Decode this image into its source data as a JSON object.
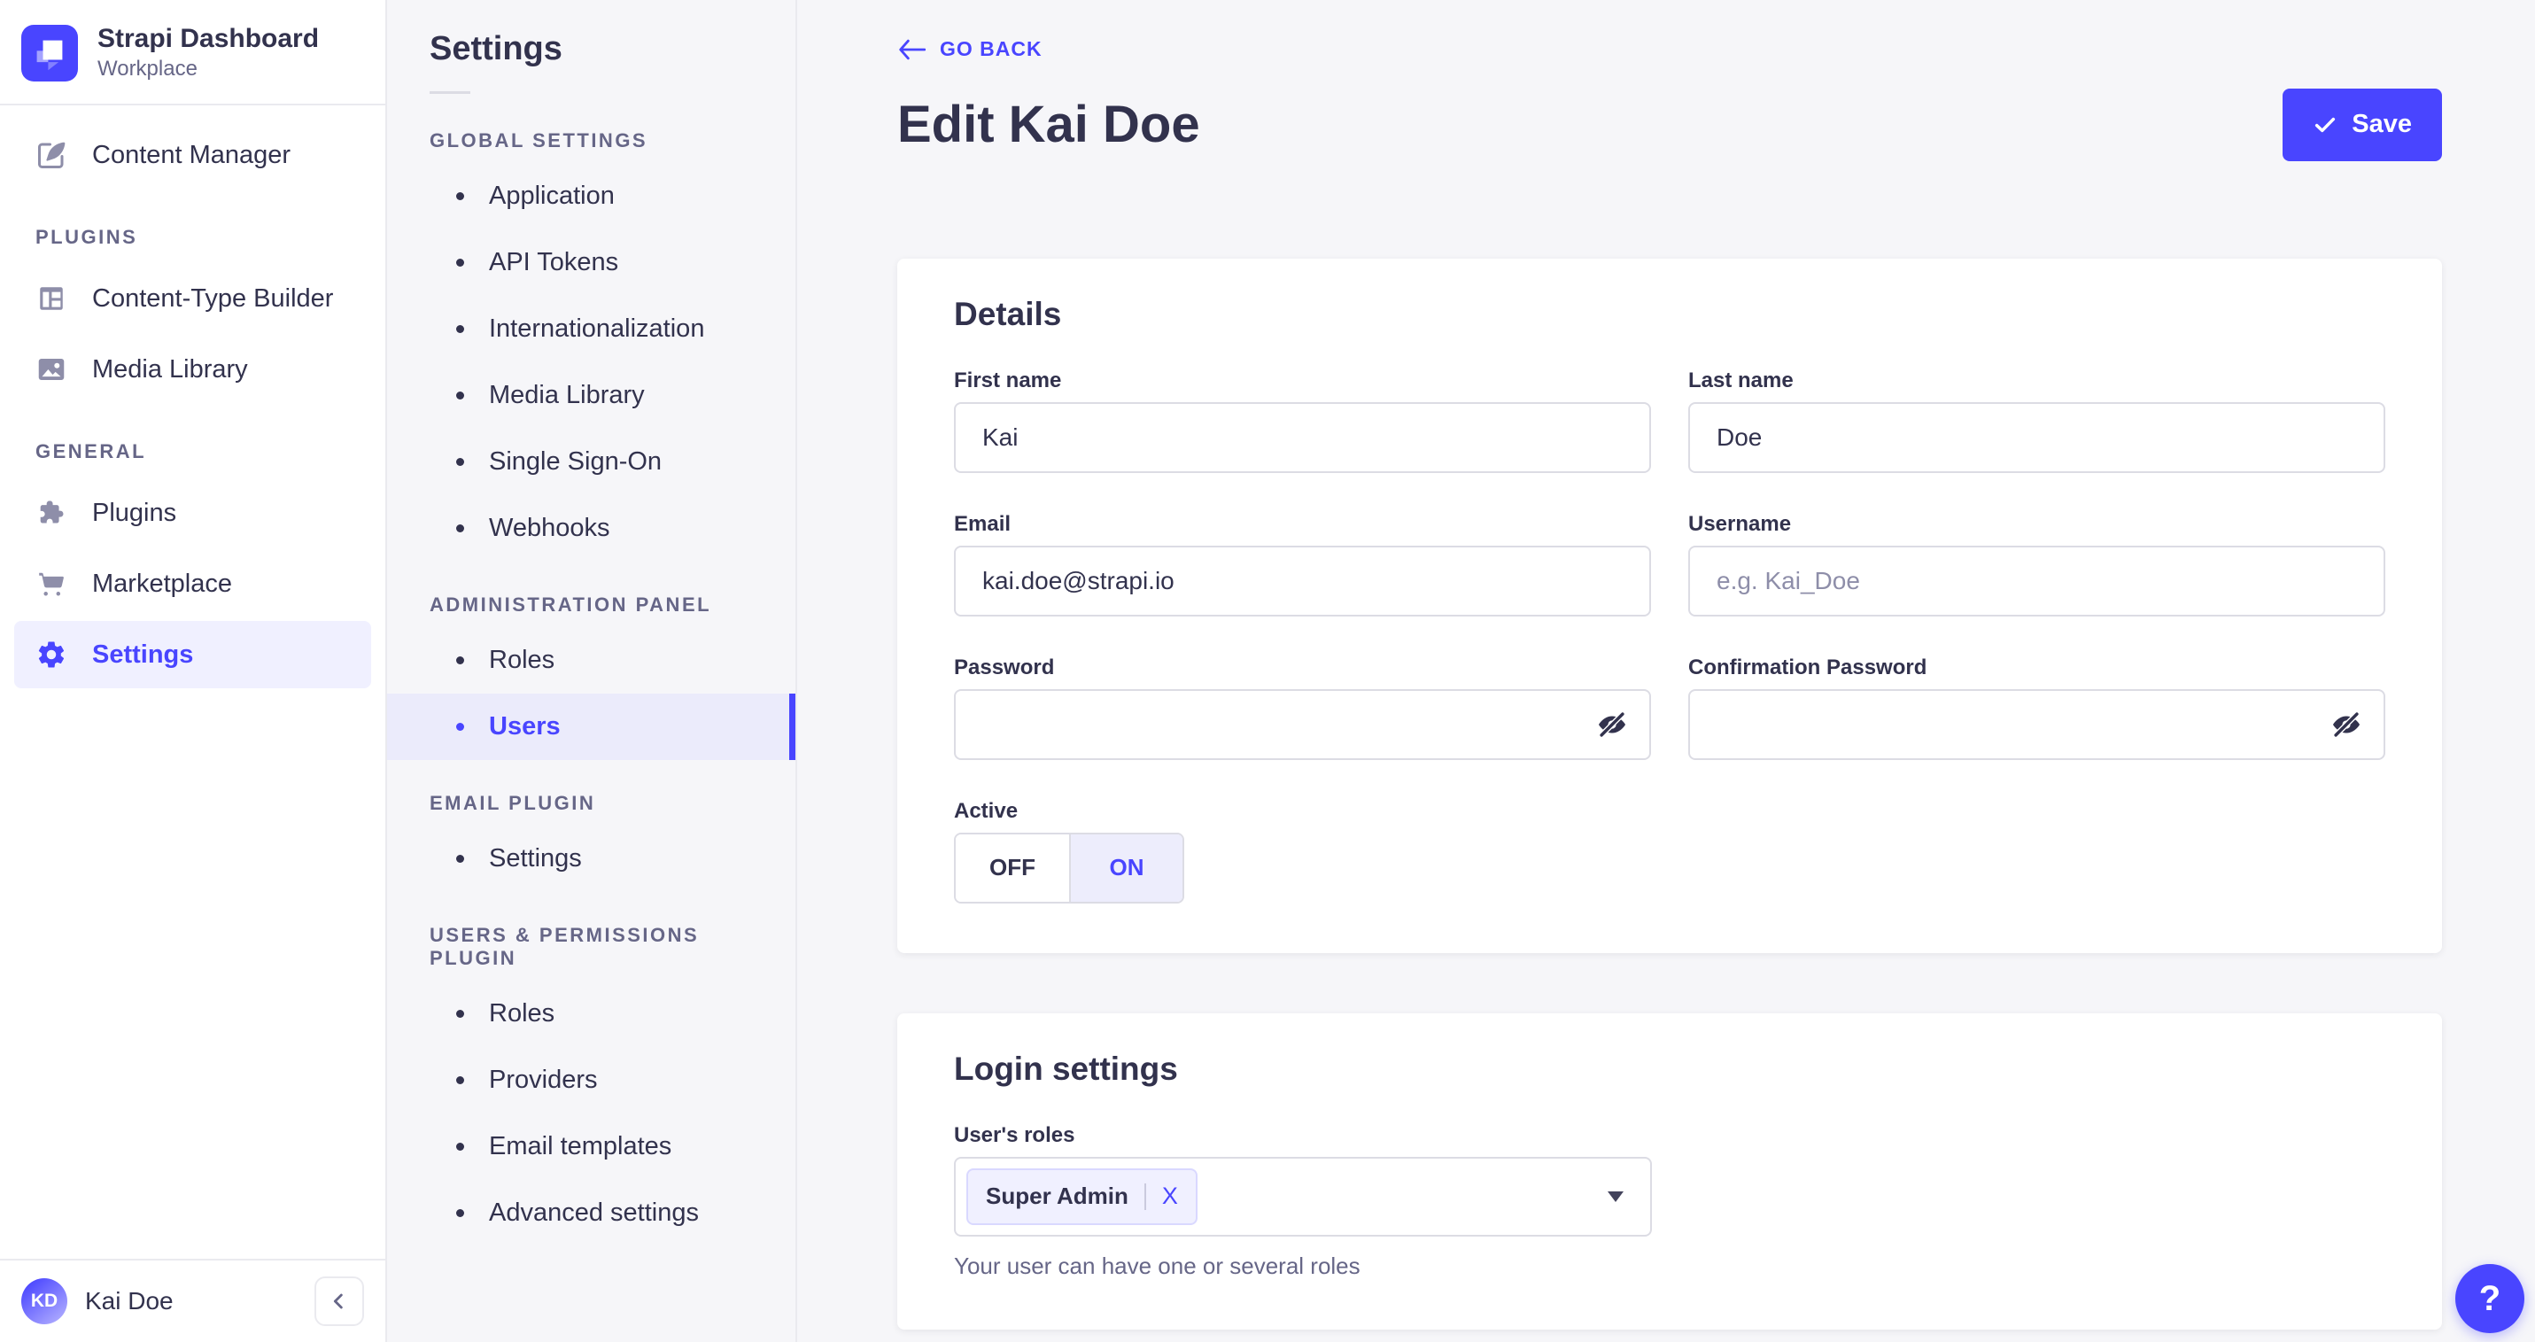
{
  "colors": {
    "primary": "#4945ff",
    "primary_light": "#f0f0ff",
    "text": "#32324d",
    "muted": "#666687",
    "border": "#dcdce4",
    "background": "#f6f6f9"
  },
  "sidebar": {
    "brand": {
      "title": "Strapi Dashboard",
      "subtitle": "Workplace"
    },
    "content_manager": {
      "label": "Content Manager",
      "icon": "feather-icon"
    },
    "sections": [
      {
        "label": "PLUGINS",
        "items": [
          {
            "label": "Content-Type Builder",
            "icon": "layout-icon"
          },
          {
            "label": "Media Library",
            "icon": "image-icon"
          }
        ]
      },
      {
        "label": "GENERAL",
        "items": [
          {
            "label": "Plugins",
            "icon": "puzzle-icon"
          },
          {
            "label": "Marketplace",
            "icon": "cart-icon"
          },
          {
            "label": "Settings",
            "icon": "gear-icon",
            "active": true
          }
        ]
      }
    ],
    "user": {
      "initials": "KD",
      "name": "Kai Doe"
    }
  },
  "subnav": {
    "title": "Settings",
    "sections": [
      {
        "label": "GLOBAL SETTINGS",
        "items": [
          {
            "label": "Application"
          },
          {
            "label": "API Tokens"
          },
          {
            "label": "Internationalization"
          },
          {
            "label": "Media Library"
          },
          {
            "label": "Single Sign-On"
          },
          {
            "label": "Webhooks"
          }
        ]
      },
      {
        "label": "ADMINISTRATION PANEL",
        "items": [
          {
            "label": "Roles"
          },
          {
            "label": "Users",
            "active": true
          }
        ]
      },
      {
        "label": "EMAIL PLUGIN",
        "items": [
          {
            "label": "Settings"
          }
        ]
      },
      {
        "label": "USERS & PERMISSIONS PLUGIN",
        "items": [
          {
            "label": "Roles"
          },
          {
            "label": "Providers"
          },
          {
            "label": "Email templates"
          },
          {
            "label": "Advanced settings"
          }
        ]
      }
    ]
  },
  "header": {
    "back_label": "GO BACK",
    "title": "Edit Kai Doe",
    "save_label": "Save"
  },
  "details": {
    "title": "Details",
    "first_name": {
      "label": "First name",
      "value": "Kai"
    },
    "last_name": {
      "label": "Last name",
      "value": "Doe"
    },
    "email": {
      "label": "Email",
      "value": "kai.doe@strapi.io"
    },
    "username": {
      "label": "Username",
      "value": "",
      "placeholder": "e.g. Kai_Doe"
    },
    "password": {
      "label": "Password",
      "value": ""
    },
    "confirmation_password": {
      "label": "Confirmation Password",
      "value": ""
    },
    "active": {
      "label": "Active",
      "off_label": "OFF",
      "on_label": "ON",
      "value": "ON"
    }
  },
  "login": {
    "title": "Login settings",
    "roles": {
      "label": "User's roles",
      "selected_tag": "Super Admin",
      "remove_label": "X",
      "hint": "Your user can have one or several roles"
    }
  },
  "help": {
    "label": "?"
  }
}
